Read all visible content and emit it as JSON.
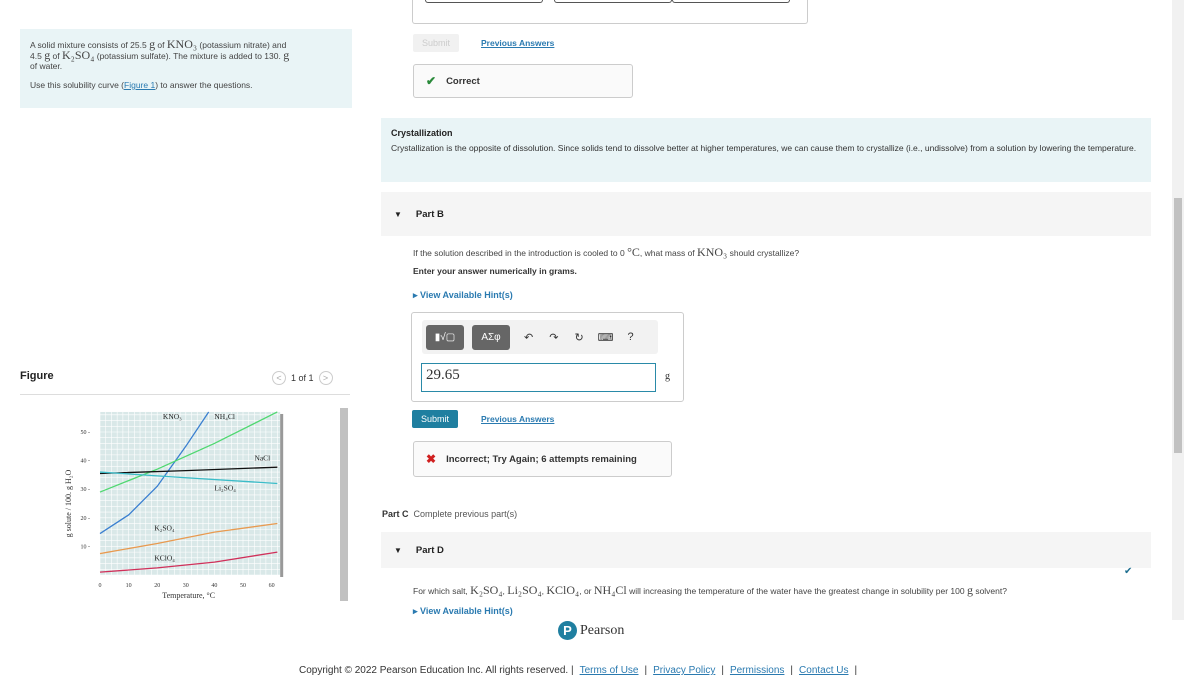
{
  "intro": {
    "line1_pre": "A solid mixture consists of 25.5 ",
    "g1": "g",
    "line1_mid": " of ",
    "kno3": "KNO₃",
    "line1_post": " (potassium nitrate) and",
    "line2_pre": "4.5 ",
    "g2": "g",
    "line2_mid": " of ",
    "k2so4": "K₂SO₄",
    "line2_post": " (potassium sulfate).  The mixture is added to 130. ",
    "g3": "g",
    "line3": "of water.",
    "use_pre": "Use this solubility curve (",
    "figure_link": "Figure 1",
    "use_post": ") to answer the questions."
  },
  "figure": {
    "title": "Figure",
    "pager": "1 of 1",
    "prev_icon": "chevron-left-icon",
    "next_icon": "chevron-right-icon"
  },
  "chart_data": {
    "type": "line",
    "xlabel": "Temperature, °C",
    "ylabel": "g solute / 100. g H₂O",
    "xlim": [
      0,
      63
    ],
    "ylim": [
      0,
      57
    ],
    "xticks": [
      "0",
      "10",
      "20",
      "30",
      "40",
      "50",
      "60"
    ],
    "yticks": [
      "10",
      "20",
      "30",
      "40",
      "50"
    ],
    "grid": true,
    "series": [
      {
        "name": "KNO₃",
        "color": "#3a7fd0",
        "points": [
          [
            0,
            14.5
          ],
          [
            10,
            21
          ],
          [
            20,
            31
          ],
          [
            30,
            45
          ],
          [
            38,
            57
          ]
        ]
      },
      {
        "name": "NH₄Cl",
        "color": "#4fd870",
        "points": [
          [
            0,
            29
          ],
          [
            20,
            37
          ],
          [
            40,
            46
          ],
          [
            62,
            57
          ]
        ]
      },
      {
        "name": "NaCl",
        "color": "#111111",
        "points": [
          [
            0,
            35.5
          ],
          [
            30,
            36.5
          ],
          [
            62,
            37.7
          ]
        ]
      },
      {
        "name": "Li₂SO₄",
        "color": "#3bbcc8",
        "points": [
          [
            0,
            36
          ],
          [
            30,
            34
          ],
          [
            62,
            32
          ]
        ]
      },
      {
        "name": "K₂SO₄",
        "color": "#e89a50",
        "points": [
          [
            0,
            7.5
          ],
          [
            20,
            11
          ],
          [
            40,
            15
          ],
          [
            62,
            18
          ]
        ]
      },
      {
        "name": "KClO₄",
        "color": "#d0305a",
        "points": [
          [
            0,
            1
          ],
          [
            20,
            2.5
          ],
          [
            40,
            4.5
          ],
          [
            62,
            8
          ]
        ]
      }
    ]
  },
  "partA": {
    "submit": "Submit",
    "previous": "Previous Answers",
    "feedback": "Correct"
  },
  "crystallization": {
    "title": "Crystallization",
    "text": "Crystallization is the opposite of dissolution. Since solids tend to dissolve better at higher temperatures, we can cause them to crystallize (i.e., undissolve) from a solution by lowering the temperature."
  },
  "partB": {
    "label": "Part B",
    "question_pre": "If the solution described in the introduction is cooled to 0 ",
    "deg": "°C",
    "question_mid": ", what mass of ",
    "kno3": "KNO₃",
    "question_post": " should crystallize?",
    "instruction": "Enter your answer numerically in grams.",
    "hint": "View Available Hint(s)",
    "toolbar": {
      "templates": "▮√▢",
      "symbols": "ΑΣφ",
      "undo": "↶",
      "redo": "↷",
      "reset": "↻",
      "keyboard": "⌨",
      "help": "?"
    },
    "value": "29.65",
    "unit": "g",
    "submit": "Submit",
    "previous": "Previous Answers",
    "feedback": "Incorrect; Try Again; 6 attempts remaining"
  },
  "partC": {
    "label": "Part C",
    "status": "Complete previous part(s)"
  },
  "partD": {
    "label": "Part D",
    "q_pre": "For which salt, ",
    "s1": "K₂SO₄",
    "s2": "Li₂SO₄",
    "s3": "KClO₄",
    "s4": "NH₄Cl",
    "q_post": " will increasing the temperature of the water have the greatest change in solubility per 100 ",
    "g": "g",
    "q_end": " solvent?",
    "hint": "View Available Hint(s)"
  },
  "brand": "Pearson",
  "footer": {
    "copyright": "Copyright © 2022 Pearson Education Inc. All rights reserved.",
    "links": [
      "Terms of Use",
      "Privacy Policy",
      "Permissions",
      "Contact Us"
    ]
  },
  "colors": {
    "accent": "#1f7fa0",
    "correct": "#2a8a3a",
    "incorrect": "#d02020",
    "panel": "#e9f4f6"
  }
}
